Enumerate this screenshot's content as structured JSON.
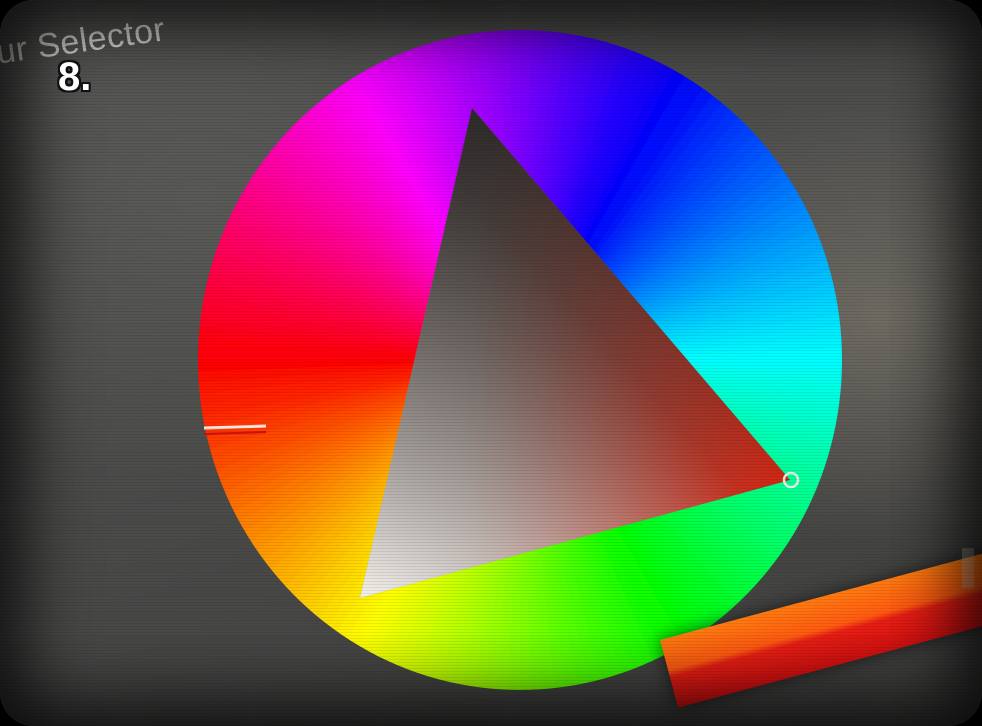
{
  "panel": {
    "title": "ur Selector"
  },
  "overlay": {
    "step_label": "8."
  },
  "color_picker": {
    "hue_ring_icon": "hue-ring",
    "saturation_value_triangle_icon": "triangle-selector",
    "selected_hue": "#ff1e0a",
    "selected_color": "#ff3a1e",
    "selector_colors": {
      "tip_black": "#1c1c1c",
      "tip_white": "#f5f2ee",
      "tip_hue": "#ff2a12"
    }
  },
  "swatches": {
    "colors": [
      "#ff7a10",
      "#e81e14"
    ]
  }
}
